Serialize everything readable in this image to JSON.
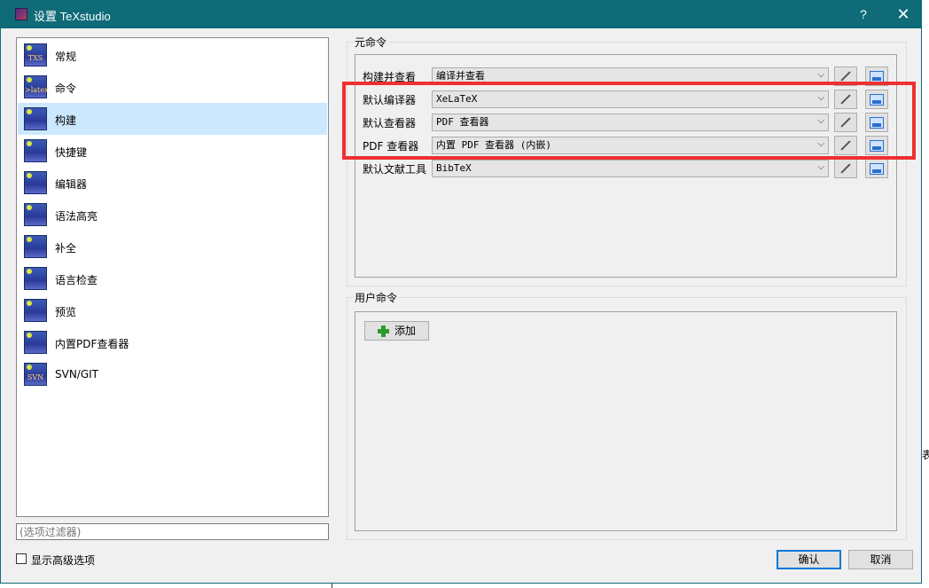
{
  "window": {
    "title": "设置 TeXstudio",
    "help_label": "?",
    "close_label": "✕"
  },
  "categories": [
    {
      "label": "常规",
      "icon": "TXS"
    },
    {
      "label": "命令",
      "icon": ">latex"
    },
    {
      "label": "构建",
      "icon": "build"
    },
    {
      "label": "快捷键",
      "icon": "keyboard"
    },
    {
      "label": "编辑器",
      "icon": "cursor"
    },
    {
      "label": "语法高亮",
      "icon": "highlight"
    },
    {
      "label": "补全",
      "icon": "completion"
    },
    {
      "label": "语言检查",
      "icon": "cursor"
    },
    {
      "label": "预览",
      "icon": "preview"
    },
    {
      "label": "内置PDF查看器",
      "icon": "pdf"
    },
    {
      "label": "SVN/GIT",
      "icon": "SVN"
    }
  ],
  "selected_category": "构建",
  "filter": {
    "placeholder": "(选项过滤器)"
  },
  "advanced": {
    "label": "显示高级选项",
    "checked": false
  },
  "meta_commands": {
    "title": "元命令",
    "rows": [
      {
        "label": "构建并查看",
        "value": "编译并查看"
      },
      {
        "label": "默认编译器",
        "value": "XeLaTeX"
      },
      {
        "label": "默认查看器",
        "value": "PDF 查看器"
      },
      {
        "label": "PDF 查看器",
        "value": "内置 PDF 查看器 (内嵌)"
      },
      {
        "label": "默认文献工具",
        "value": "BibTeX"
      }
    ]
  },
  "user_commands": {
    "title": "用户命令",
    "add_label": "添加"
  },
  "buttons": {
    "ok": "确认",
    "cancel": "取消"
  },
  "outside_text": "表",
  "colors": {
    "titlebar": "#0f6b78",
    "selection": "#cce8ff",
    "highlight": "#ee3030"
  }
}
